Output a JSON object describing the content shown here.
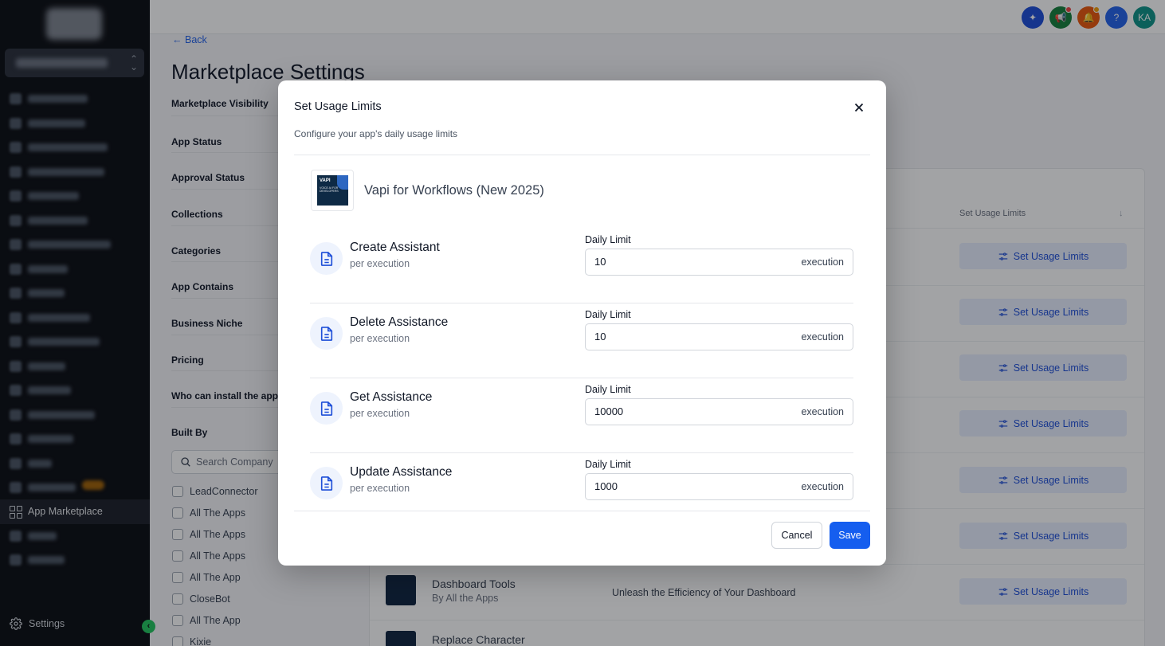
{
  "sidebar": {
    "active_item": "App Marketplace",
    "settings_label": "Settings"
  },
  "topbar": {
    "avatar_initials": "KA",
    "help_label": "?"
  },
  "page": {
    "back_label": "Back",
    "title": "Marketplace Settings",
    "filters": [
      "Marketplace Visibility",
      "App Status",
      "Approval Status",
      "Collections",
      "Categories",
      "App Contains",
      "Business Niche",
      "Pricing",
      "Who can install the app?",
      "Built By"
    ],
    "search_company_placeholder": "Search Company",
    "companies": [
      "LeadConnector",
      "All The Apps",
      "All The Apps",
      "All The Apps",
      "All The App",
      "CloseBot",
      "All The App",
      "Kixie"
    ],
    "table_header_usage": "Set Usage Limits",
    "usage_button_label": "Set Usage Limits",
    "rows": [
      {
        "name": "Dashboard Tools",
        "by": "By All the Apps",
        "desc": "Unleash the Efficiency of Your Dashboard"
      },
      {
        "name": "Replace Character",
        "by": "",
        "desc": ""
      }
    ]
  },
  "modal": {
    "title": "Set Usage Limits",
    "subtitle": "Configure your app's daily usage limits",
    "app_name": "Vapi for Workflows (New 2025)",
    "thumb_title": "VAPI",
    "thumb_text": "VOICE AI FOR DEVELOPERS",
    "daily_limit_label": "Daily Limit",
    "unit_suffix": "execution",
    "limits": [
      {
        "name": "Create Assistant",
        "unit": "per execution",
        "value": "10"
      },
      {
        "name": "Delete Assistance",
        "unit": "per execution",
        "value": "10"
      },
      {
        "name": "Get Assistance",
        "unit": "per execution",
        "value": "10000"
      },
      {
        "name": "Update Assistance",
        "unit": "per execution",
        "value": "1000"
      }
    ],
    "cancel_label": "Cancel",
    "save_label": "Save"
  },
  "colors": {
    "primary": "#155eef",
    "sidebar_bg": "#0b0d12",
    "usage_button_bg": "#e8efff"
  }
}
